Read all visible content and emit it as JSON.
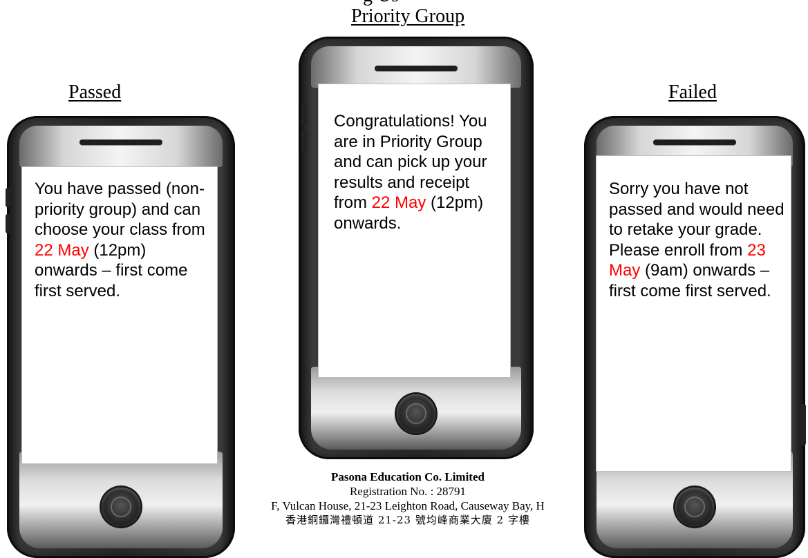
{
  "top_fragment": "g Us",
  "groups": {
    "priority": {
      "label": "Priority Group",
      "message": {
        "before": "Congratulations! You are in Priority Group and can pick up your results and receipt from ",
        "highlight": "22 May",
        "after": " (12pm) onwards."
      }
    },
    "passed": {
      "label": "Passed",
      "message": {
        "before": "You have passed (non-priority group) and can choose your class from ",
        "highlight": "22 May",
        "after": " (12pm) onwards – first come first served."
      }
    },
    "failed": {
      "label": "Failed",
      "message": {
        "before": "Sorry you have not passed and would need to retake your grade. Please enroll from ",
        "highlight": "23 May",
        "after": " (9am) onwards – first come first served."
      }
    }
  },
  "footer": {
    "company": "Pasona Education Co. Limited",
    "registration": "Registration No. : 28791",
    "address": "F, Vulcan House, 21-23 Leighton Road, Causeway Bay, H",
    "address_chinese": "香港銅鑼灣禮頓道 21-23 號均峰商業大廈 2 字樓"
  },
  "colors": {
    "highlight": "#ff0000",
    "phone_body": "#2a2a2a",
    "screen": "#ffffff"
  }
}
